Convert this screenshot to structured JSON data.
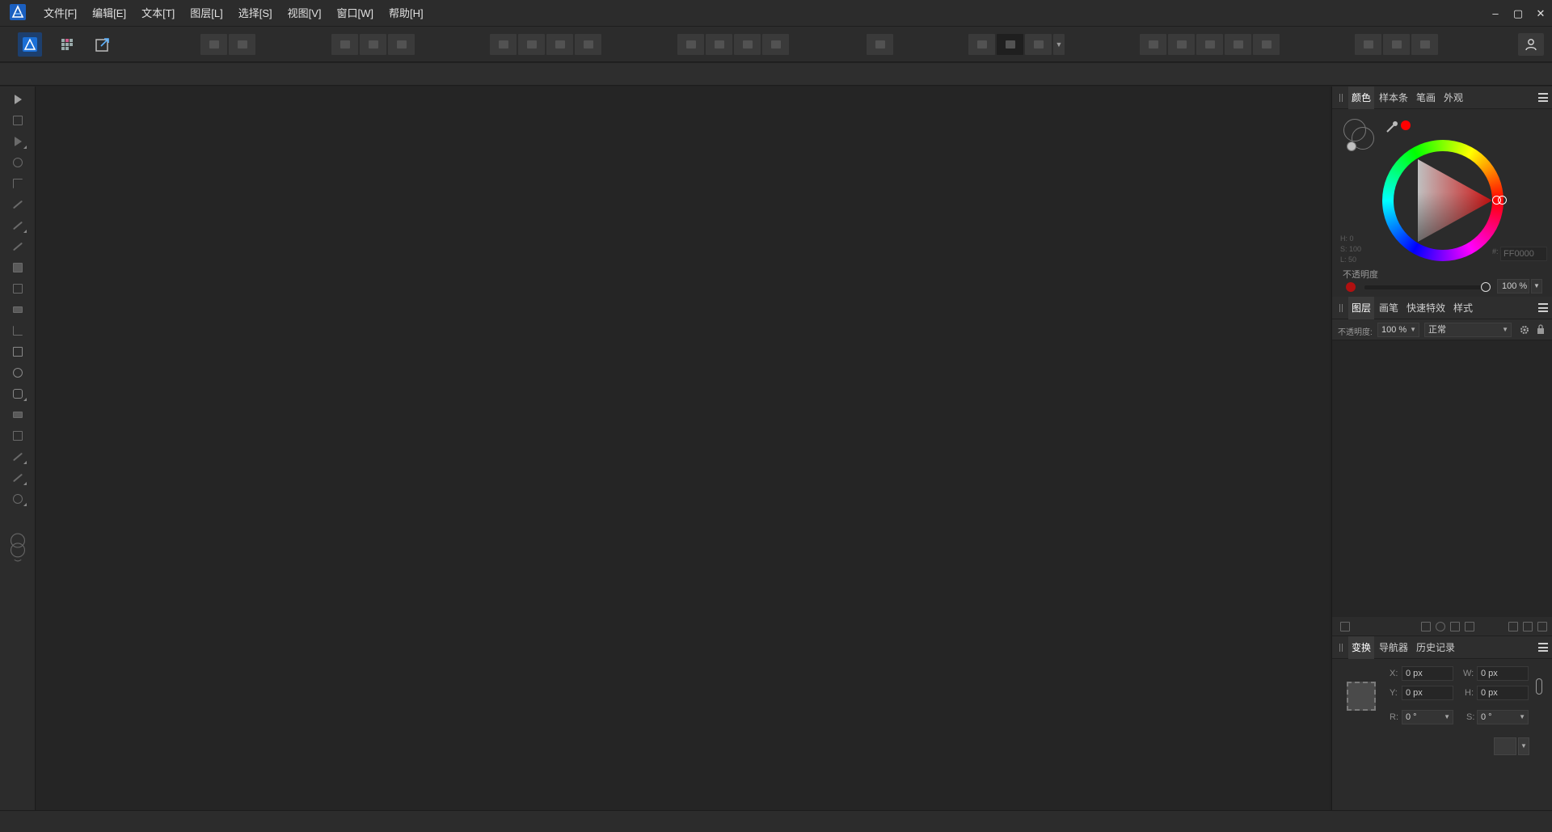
{
  "menu": {
    "items": [
      "文件[F]",
      "编辑[E]",
      "文本[T]",
      "图层[L]",
      "选择[S]",
      "视图[V]",
      "窗口[W]",
      "帮助[H]"
    ]
  },
  "window": {
    "minimize": "‒",
    "maximize": "▢",
    "close": "✕"
  },
  "icons": {
    "app_logo": "affinity-designer-logo-icon",
    "persona_designer": "designer-persona-icon",
    "persona_pixel": "pixel-persona-icon",
    "persona_export": "export-persona-icon",
    "account": "user-icon"
  },
  "color_panel": {
    "tabs": [
      "颜色",
      "样本条",
      "笔画",
      "外观"
    ],
    "active_tab": 0,
    "hsl": {
      "h": "H: 0",
      "s": "S: 100",
      "l": "L: 50"
    },
    "hex_prefix": "#:",
    "hex": "FF0000",
    "opacity_label": "不透明度",
    "opacity_value": "100 %",
    "opacity_fraction": 1.0,
    "current_color": "#ff0000"
  },
  "layers_panel": {
    "tabs": [
      "图层",
      "画笔",
      "快速特效",
      "样式"
    ],
    "active_tab": 0,
    "opacity_label": "不透明度:",
    "opacity_value": "100 %",
    "blend_mode": "正常"
  },
  "transform_panel": {
    "tabs": [
      "变换",
      "导航器",
      "历史记录"
    ],
    "active_tab": 0,
    "x_label": "X:",
    "x_value": "0 px",
    "y_label": "Y:",
    "y_value": "0 px",
    "w_label": "W:",
    "w_value": "0 px",
    "h_label": "H:",
    "h_value": "0 px",
    "r_label": "R:",
    "r_value": "0 °",
    "s_label": "S:",
    "s_value": "0 °"
  },
  "colors": {
    "accent": "#1d6fd1",
    "background": "#252525",
    "panel": "#2b2b2b"
  }
}
